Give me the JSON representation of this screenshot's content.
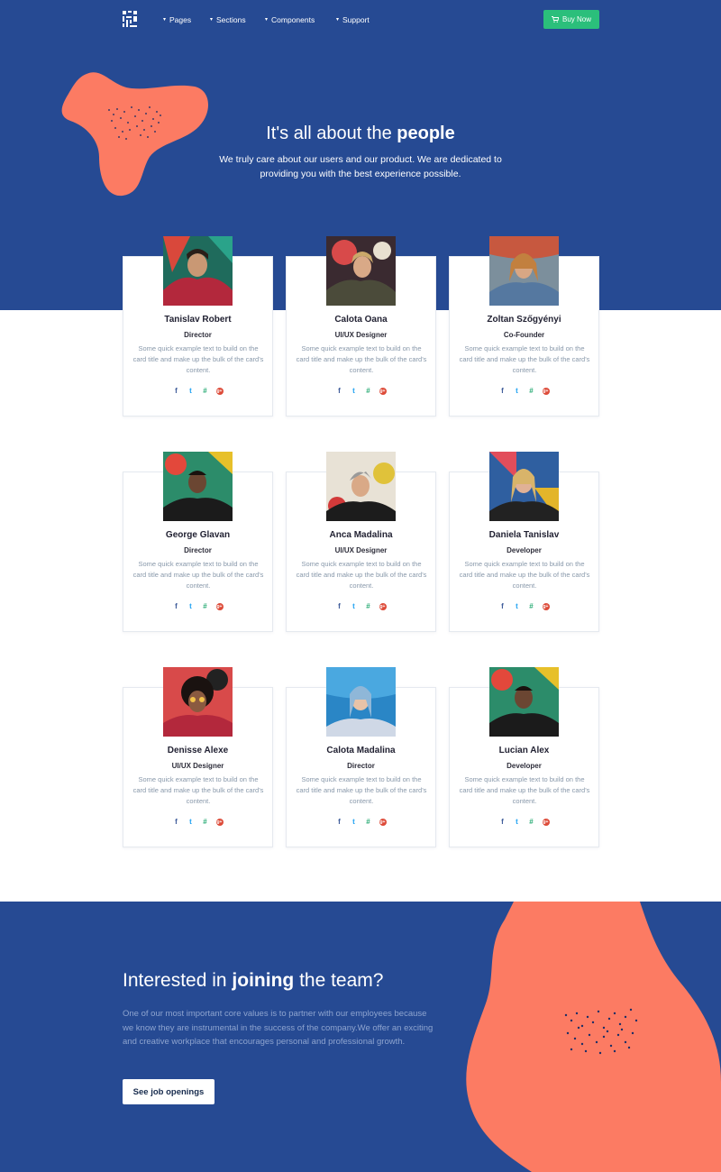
{
  "nav": {
    "items": [
      {
        "label": "Pages"
      },
      {
        "label": "Sections"
      },
      {
        "label": "Components"
      },
      {
        "label": "Support"
      }
    ],
    "buy_label": "Buy Now",
    "buy_icon": "cart-icon",
    "logo_icon": "logo-icon"
  },
  "hero": {
    "title_prefix": "It's all about the ",
    "title_emphasis": "people",
    "subtitle": "We truly care about our users and our product. We are dedicated to providing you with the best experience possible."
  },
  "colors": {
    "primary_blue": "#264a93",
    "accent_coral": "#fc7b63",
    "buy_green": "#2bbf7b"
  },
  "team": {
    "members": [
      {
        "name": "Tanislav Robert",
        "role": "Director",
        "desc": "Some quick example text to build on the card title and make up the bulk of the card's content."
      },
      {
        "name": "Calota Oana",
        "role": "UI/UX Designer",
        "desc": "Some quick example text to build on the card title and make up the bulk of the card's content."
      },
      {
        "name": "Zoltan Szőgyényi",
        "role": "Co-Founder",
        "desc": "Some quick example text to build on the card title and make up the bulk of the card's content."
      },
      {
        "name": "George Glavan",
        "role": "Director",
        "desc": "Some quick example text to build on the card title and make up the bulk of the card's content."
      },
      {
        "name": "Anca Madalina",
        "role": "UI/UX Designer",
        "desc": "Some quick example text to build on the card title and make up the bulk of the card's content."
      },
      {
        "name": "Daniela Tanislav",
        "role": "Developer",
        "desc": "Some quick example text to build on the card title and make up the bulk of the card's content."
      },
      {
        "name": "Denisse Alexe",
        "role": "UI/UX Designer",
        "desc": "Some quick example text to build on the card title and make up the bulk of the card's content."
      },
      {
        "name": "Calota Madalina",
        "role": "Director",
        "desc": "Some quick example text to build on the card title and make up the bulk of the card's content."
      },
      {
        "name": "Lucian Alex",
        "role": "Developer",
        "desc": "Some quick example text to build on the card title and make up the bulk of the card's content."
      }
    ],
    "social_icons": [
      "facebook-icon",
      "twitter-icon",
      "slack-icon",
      "google-plus-icon"
    ]
  },
  "join": {
    "title_prefix": "Interested in ",
    "title_emphasis": "joining",
    "title_suffix": " the team?",
    "text": "One of our most important core values is to partner with our employees because we know they are instrumental in the success of the company.We offer an exciting and creative workplace that encourages personal and professional growth.",
    "button_label": "See job openings"
  }
}
